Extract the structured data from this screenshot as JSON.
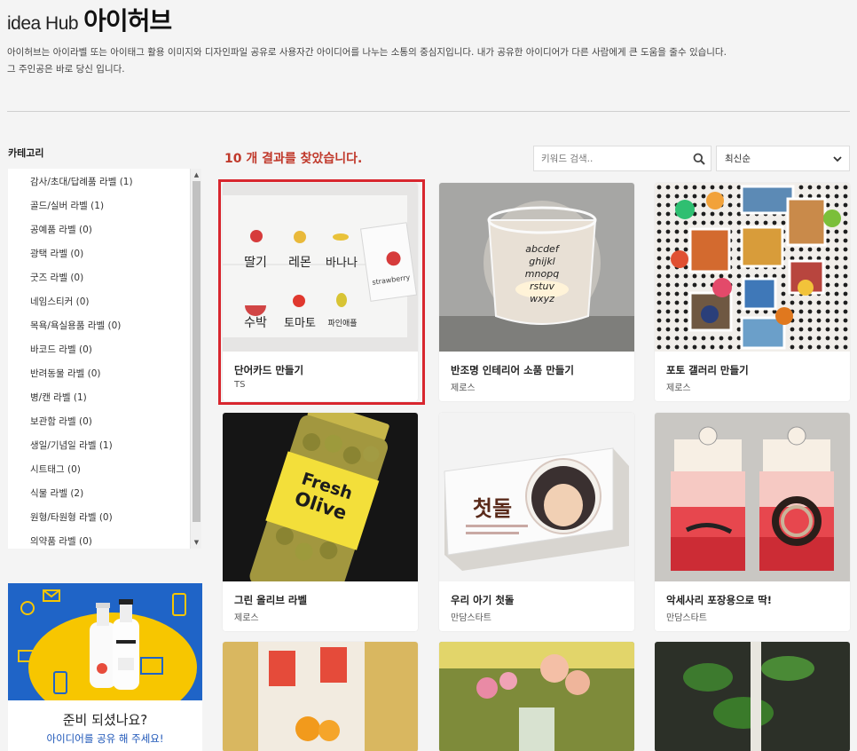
{
  "header": {
    "logo_en": "idea Hub",
    "logo_ko": "아이허브",
    "intro_line1": "아이허브는 아이라벨 또는 아이태그 활용 이미지와 디자인파일 공유로 사용자간 아이디어를 나누는 소통의 중심지입니다. 내가 공유한 아이디어가 다른 사람에게 큰 도움을 줄수 있습니다.",
    "intro_line2": "그 주인공은 바로 당신 입니다."
  },
  "sidebar": {
    "title": "카테고리",
    "categories": [
      "감사/초대/답례품 라벨 (1)",
      "골드/실버 라벨 (1)",
      "공예품 라벨 (0)",
      "광택 라벨 (0)",
      "굿즈 라벨 (0)",
      "네임스티커 (0)",
      "목욕/욕실용품 라벨 (0)",
      "바코드 라벨 (0)",
      "반려동물 라벨 (0)",
      "병/캔 라벨 (1)",
      "보관함 라벨 (0)",
      "생일/기념일 라벨 (1)",
      "시트태그 (0)",
      "식물 라벨 (2)",
      "원형/타원형 라벨 (0)",
      "의약품 라벨 (0)"
    ],
    "scroll_up_icon": "triangle-up",
    "scroll_down_icon": "triangle-down"
  },
  "promo": {
    "title": "준비 되셨나요?",
    "subtitle": "아이디어를 공유 해 주세요!",
    "colors": {
      "background": "#1f64c7",
      "accent": "#f7c600"
    }
  },
  "main": {
    "result_count": "10 개 결과를 찾았습니다.",
    "search_placeholder": "키워드 검색..",
    "search_icon": "magnifier",
    "sort_selected": "최신순",
    "sort_icon": "chevron-down"
  },
  "cards": [
    {
      "title": "단어카드 만들기",
      "author": "TS",
      "highlighted": true,
      "words": [
        "딸기",
        "레몬",
        "바나나",
        "수박",
        "토마토",
        "파인애플"
      ],
      "label_text": "strawberry"
    },
    {
      "title": "반조명 인테리어 소품 만들기",
      "author": "제로스",
      "candle_text": [
        "abcdef",
        "ghijkl",
        "mnopq",
        "rstuv",
        "wxyz"
      ]
    },
    {
      "title": "포토 갤러리 만들기",
      "author": "제로스"
    },
    {
      "title": "그린 올리브 라벨",
      "author": "제로스",
      "label_text": [
        "Fresh",
        "Olive"
      ]
    },
    {
      "title": "우리 아기 첫돌",
      "author": "만담스타트",
      "label_text": "첫돌"
    },
    {
      "title": "악세사리 포장용으로 딱!",
      "author": "만담스타트"
    },
    {
      "title": "",
      "author": ""
    },
    {
      "title": "",
      "author": ""
    },
    {
      "title": "",
      "author": ""
    }
  ],
  "colors": {
    "accent_red": "#c0392b",
    "highlight_border": "#d8262e",
    "page_bg": "#f4f4f4"
  }
}
